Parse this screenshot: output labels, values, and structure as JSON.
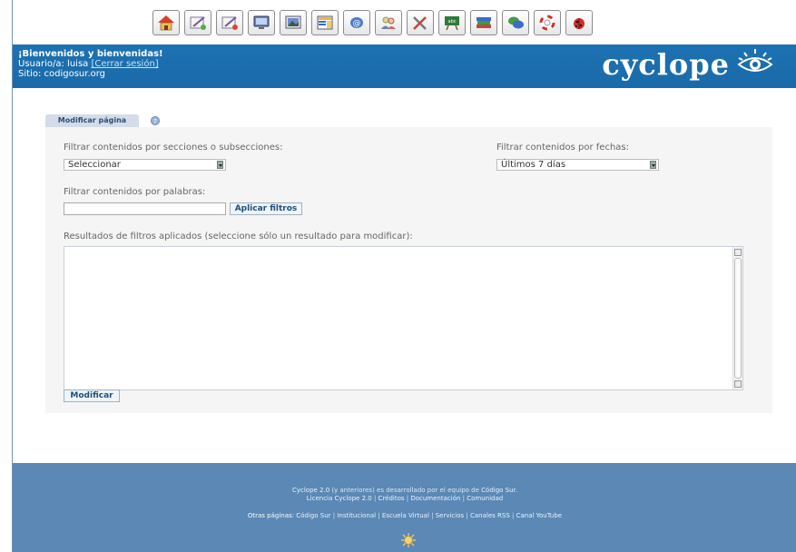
{
  "toolbar": {
    "icons": [
      "home-icon",
      "edit-icon",
      "edit-alt-icon",
      "screen-icon",
      "image-icon",
      "layout-icon",
      "email-icon",
      "users-icon",
      "tools-icon",
      "spellcheck-icon",
      "books-icon",
      "chat-icon",
      "help-ring-icon",
      "bug-icon"
    ]
  },
  "header": {
    "welcome": "¡Bienvenidos y bienvenidas!",
    "user_prefix": "Usuario/a: luisa ",
    "logout": "[Cerrar sesión]",
    "site": "Sitio: codigosur.org",
    "logo": "cyclope"
  },
  "tab": {
    "label": "Modificar página"
  },
  "filters": {
    "sections_label": "Filtrar contenidos por secciones o subsecciones:",
    "sections_value": "Seleccionar",
    "dates_label": "Filtrar contenidos por fechas:",
    "dates_value": "Últimos 7 días",
    "words_label": "Filtrar contenidos por palabras:",
    "words_value": "",
    "apply_button": "Aplicar filtros",
    "results_label": "Resultados de filtros aplicados (seleccione sólo un resultado para modificar):",
    "modify_button": "Modificar"
  },
  "footer": {
    "line1_a": "Cyclope 2.0",
    "line1_b": " (y anteriores) es desarrollado por el equipo de ",
    "line1_c": "Código Sur",
    "line1_d": ".",
    "line2": [
      "Licencia Cyclope 2.0",
      "Créditos",
      "Documentación",
      "Comunidad"
    ],
    "other_label": "Otras páginas: ",
    "other_links": [
      "Código Sur",
      "Institucional",
      "Escuela Virtual",
      "Servicios",
      "Canales RSS",
      "Canal YouTube"
    ]
  },
  "colors": {
    "header_blue": "#1a6aa8",
    "footer_blue": "#5b88b5",
    "tab_bg": "#d3dce8"
  }
}
